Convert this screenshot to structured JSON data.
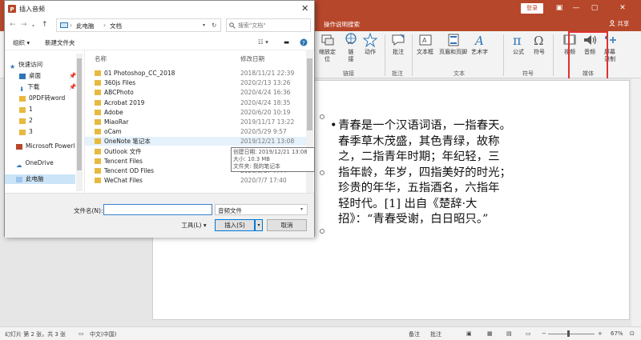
{
  "ppt": {
    "login_label": "登录",
    "tell_me": "操作说明搜索",
    "share_label": "共享",
    "ribbon": {
      "buttons": [
        {
          "id": "zoom",
          "label1": "缩放定",
          "label2": "位"
        },
        {
          "id": "link",
          "label1": "链",
          "label2": "接"
        },
        {
          "id": "action",
          "label1": "动作",
          "label2": ""
        },
        {
          "id": "comment",
          "label1": "批注",
          "label2": ""
        },
        {
          "id": "textbox",
          "label1": "文本框",
          "label2": ""
        },
        {
          "id": "headerfooter",
          "label1": "页眉和页脚",
          "label2": ""
        },
        {
          "id": "wordart",
          "label1": "艺术字",
          "label2": ""
        },
        {
          "id": "formula",
          "label1": "公式",
          "label2": ""
        },
        {
          "id": "symbol",
          "label1": "符号",
          "label2": ""
        },
        {
          "id": "video",
          "label1": "视频",
          "label2": ""
        },
        {
          "id": "audio",
          "label1": "音频",
          "label2": ""
        },
        {
          "id": "screenrec",
          "label1": "屏幕",
          "label2": "录制"
        }
      ],
      "groups": [
        "链接",
        "批注",
        "文本",
        "符号",
        "媒体"
      ]
    },
    "slide_text": [
      "青春是一个汉语词语，一指春天。",
      "春季草木茂盛，其色青绿，故称",
      "之，二指青年时期；年纪轻，三",
      "指年龄，年岁，四指美好的时光；",
      "珍贵的年华，五指酒名，六指年",
      "轻时代。[1] 出自《楚辞·大",
      "招》：“青春受谢，白日昭只。”"
    ],
    "status": {
      "slide_info": "幻灯片 第 2 张，共 3 张",
      "language": "中文(中国)",
      "notes": "备注",
      "comments": "批注",
      "zoom": "67%"
    }
  },
  "dialog": {
    "title": "插入音频",
    "address": [
      "此电脑",
      "文档"
    ],
    "search_placeholder": "搜索\"文档\"",
    "toolbar": {
      "organize": "组织 ▾",
      "new_folder": "新建文件夹"
    },
    "nav_items": [
      {
        "label": "快速访问",
        "kind": "star"
      },
      {
        "label": "桌面",
        "kind": "desktop"
      },
      {
        "label": "下载",
        "kind": "download"
      },
      {
        "label": "0PDF转word",
        "kind": "folder"
      },
      {
        "label": "1",
        "kind": "folder"
      },
      {
        "label": "2",
        "kind": "folder"
      },
      {
        "label": "3",
        "kind": "folder"
      },
      {
        "label": "Microsoft Powerl",
        "kind": "ppt"
      },
      {
        "label": "OneDrive",
        "kind": "cloud"
      },
      {
        "label": "此电脑",
        "kind": "pc"
      }
    ],
    "columns": {
      "name": "名称",
      "date": "修改日期"
    },
    "files": [
      {
        "name": "01 Photoshop_CC_2018",
        "date": "2018/11/21 22:39"
      },
      {
        "name": "360js Files",
        "date": "2020/2/13 13:26"
      },
      {
        "name": "ABCPhoto",
        "date": "2020/4/24 16:36"
      },
      {
        "name": "Acrobat 2019",
        "date": "2020/4/24 18:35"
      },
      {
        "name": "Adobe",
        "date": "2020/6/20 10:19"
      },
      {
        "name": "MiaoRar",
        "date": "2019/11/17 13:22"
      },
      {
        "name": "oCam",
        "date": "2020/5/29 9:57"
      },
      {
        "name": "OneNote 笔记本",
        "date": "2019/12/21 13:08"
      },
      {
        "name": "Outlook 文件",
        "date": "2020/"
      },
      {
        "name": "Tencent Files",
        "date": "2020/"
      },
      {
        "name": "Tencent OD Files",
        "date": "2020/3/17 7:44"
      },
      {
        "name": "WeChat Files",
        "date": "2020/7/7 17:40"
      }
    ],
    "tooltip": {
      "created": "创建日期: 2019/12/21 13:08",
      "size": "大小: 10.3 MB",
      "folders": "文件夹: 我的笔记本"
    },
    "filename_label": "文件名(N):",
    "filename_value": "",
    "filetype": "音频文件",
    "tools_label": "工具(L)",
    "insert_label": "插入(S)",
    "cancel_label": "取消"
  },
  "colors": {
    "ppt_red": "#b7472a",
    "highlight": "#e03030",
    "folder": "#e8b940"
  }
}
